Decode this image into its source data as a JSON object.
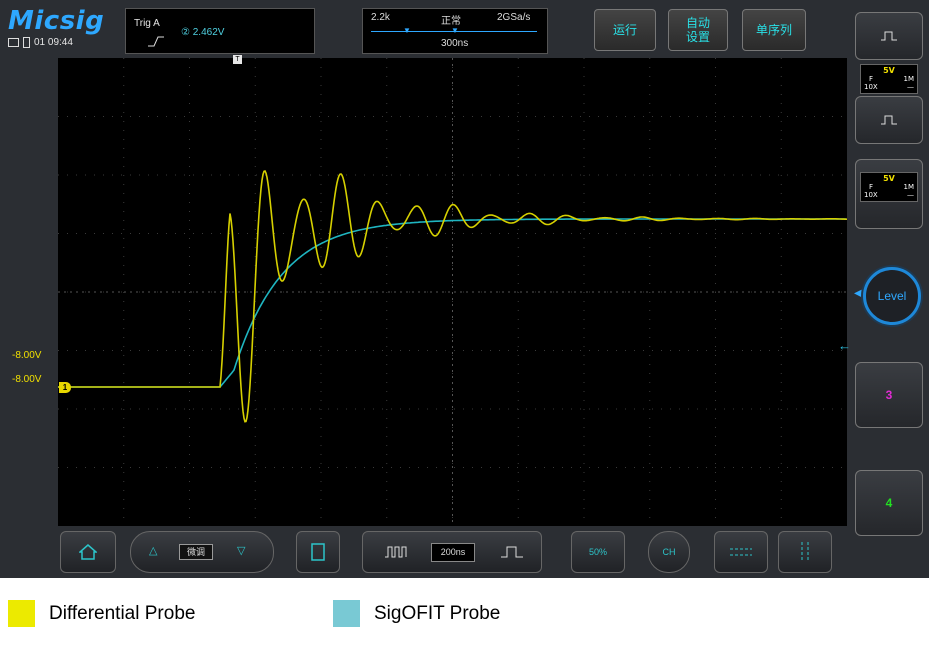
{
  "header": {
    "logo": "Micsig",
    "status": {
      "screen_icon": "monitor-icon",
      "battery_icon": "battery-icon",
      "time": "01 09:44"
    },
    "trigger": {
      "label": "Trig  A",
      "source": "② 2.462V"
    },
    "timebase": {
      "memory": "2.2k",
      "mode": "正常",
      "sample_rate": "2GSa/s",
      "scale": "300ns"
    },
    "buttons": {
      "run": "运行",
      "auto": "自动\n设置",
      "single": "单序列"
    }
  },
  "side": {
    "ch1": {
      "volts": "5V",
      "coupling": "F",
      "impedance": "1M",
      "probe": "10X",
      "dc": "—"
    },
    "ch2": {
      "volts": "5V",
      "coupling": "F",
      "impedance": "1M",
      "probe": "10X",
      "dc": "—"
    },
    "level": "Level",
    "ch3": "3",
    "ch4": "4"
  },
  "plot": {
    "offset_label_1": "-8.00V",
    "offset_label_2": "-8.00V",
    "ch1_marker": "1",
    "colors": {
      "ch1": "#d6d000",
      "ch2": "#1fb5c0"
    }
  },
  "bottom": {
    "fine": "微调",
    "timebase_value": "200ns",
    "fifty": "50%",
    "ch": "CH"
  },
  "legend": [
    {
      "label": "Differential Probe",
      "color": "#ecea00"
    },
    {
      "label": "SigOFIT Probe",
      "color": "#79c9d4"
    }
  ]
}
